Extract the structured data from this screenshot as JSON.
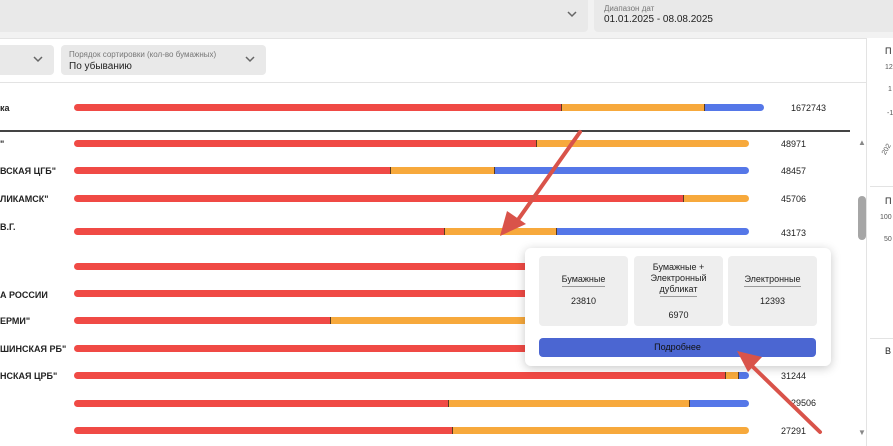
{
  "filters": {
    "date_label": "Диапазон дат",
    "date_value": "01.01.2025 - 08.08.2025",
    "sort_label": "Порядок сортировки (кол-во бумажных)",
    "sort_value": "По убыванию"
  },
  "colors": {
    "paper": "#f04a45",
    "paper_electronic": "#f7a93c",
    "electronic": "#5577e8",
    "button": "#4b66d2",
    "arrow": "#d9534a"
  },
  "chart_data": {
    "type": "bar",
    "stacked": true,
    "orientation": "horizontal",
    "series_colors": [
      "#f04a45",
      "#f7a93c",
      "#5577e8"
    ],
    "rows": [
      {
        "label": "ка",
        "total": "1672743",
        "shares": [
          0.707,
          0.207,
          0.086
        ]
      },
      {
        "label": "\"",
        "total": "48971",
        "shares": [
          0.686,
          0.314,
          0.0
        ]
      },
      {
        "label": "ВСКАЯ ЦГБ\"",
        "total": "48457",
        "shares": [
          0.469,
          0.155,
          0.376
        ]
      },
      {
        "label": "ЛИКАМСК\"",
        "total": "45706",
        "shares": [
          0.903,
          0.097,
          0.0
        ]
      },
      {
        "label": "В.Г.",
        "total": "43173",
        "shares": [
          0.549,
          0.167,
          0.284
        ]
      },
      {
        "label": "",
        "total": "",
        "shares": [
          1.0,
          0.0,
          0.0
        ]
      },
      {
        "label": "А РОССИИ",
        "total": "",
        "shares": [
          1.0,
          0.0,
          0.0
        ]
      },
      {
        "label": "ЕРМИ\"",
        "total": "",
        "shares": [
          0.38,
          0.62,
          0.0
        ]
      },
      {
        "label": "ШИНСКАЯ РБ\"",
        "total": "",
        "shares": [
          1.0,
          0.0,
          0.0
        ]
      },
      {
        "label": "НСКАЯ ЦРБ\"",
        "total": "31244",
        "shares": [
          0.966,
          0.019,
          0.015
        ]
      },
      {
        "label": "",
        "total": "29506",
        "shares": [
          0.556,
          0.356,
          0.088
        ]
      },
      {
        "label": "",
        "total": "27291",
        "shares": [
          0.562,
          0.438,
          0.0
        ]
      }
    ]
  },
  "tooltip": {
    "paper_label": "Бумажные",
    "paper_value": "23810",
    "mixed_label_1": "Бумажные +",
    "mixed_label_2": "Электронный",
    "mixed_label_3": "дубликат",
    "mixed_value": "6970",
    "electronic_label": "Электронные",
    "electronic_value": "12393",
    "more_button": "Подробнее"
  },
  "right_panel": {
    "frag_a1": "П",
    "frag_a2": "12",
    "frag_a3": "1",
    "frag_a4": "-1",
    "frag_a5": "202",
    "frag_b1": "П",
    "frag_b2": "100",
    "frag_b3": "50",
    "frag_c1": "В"
  }
}
